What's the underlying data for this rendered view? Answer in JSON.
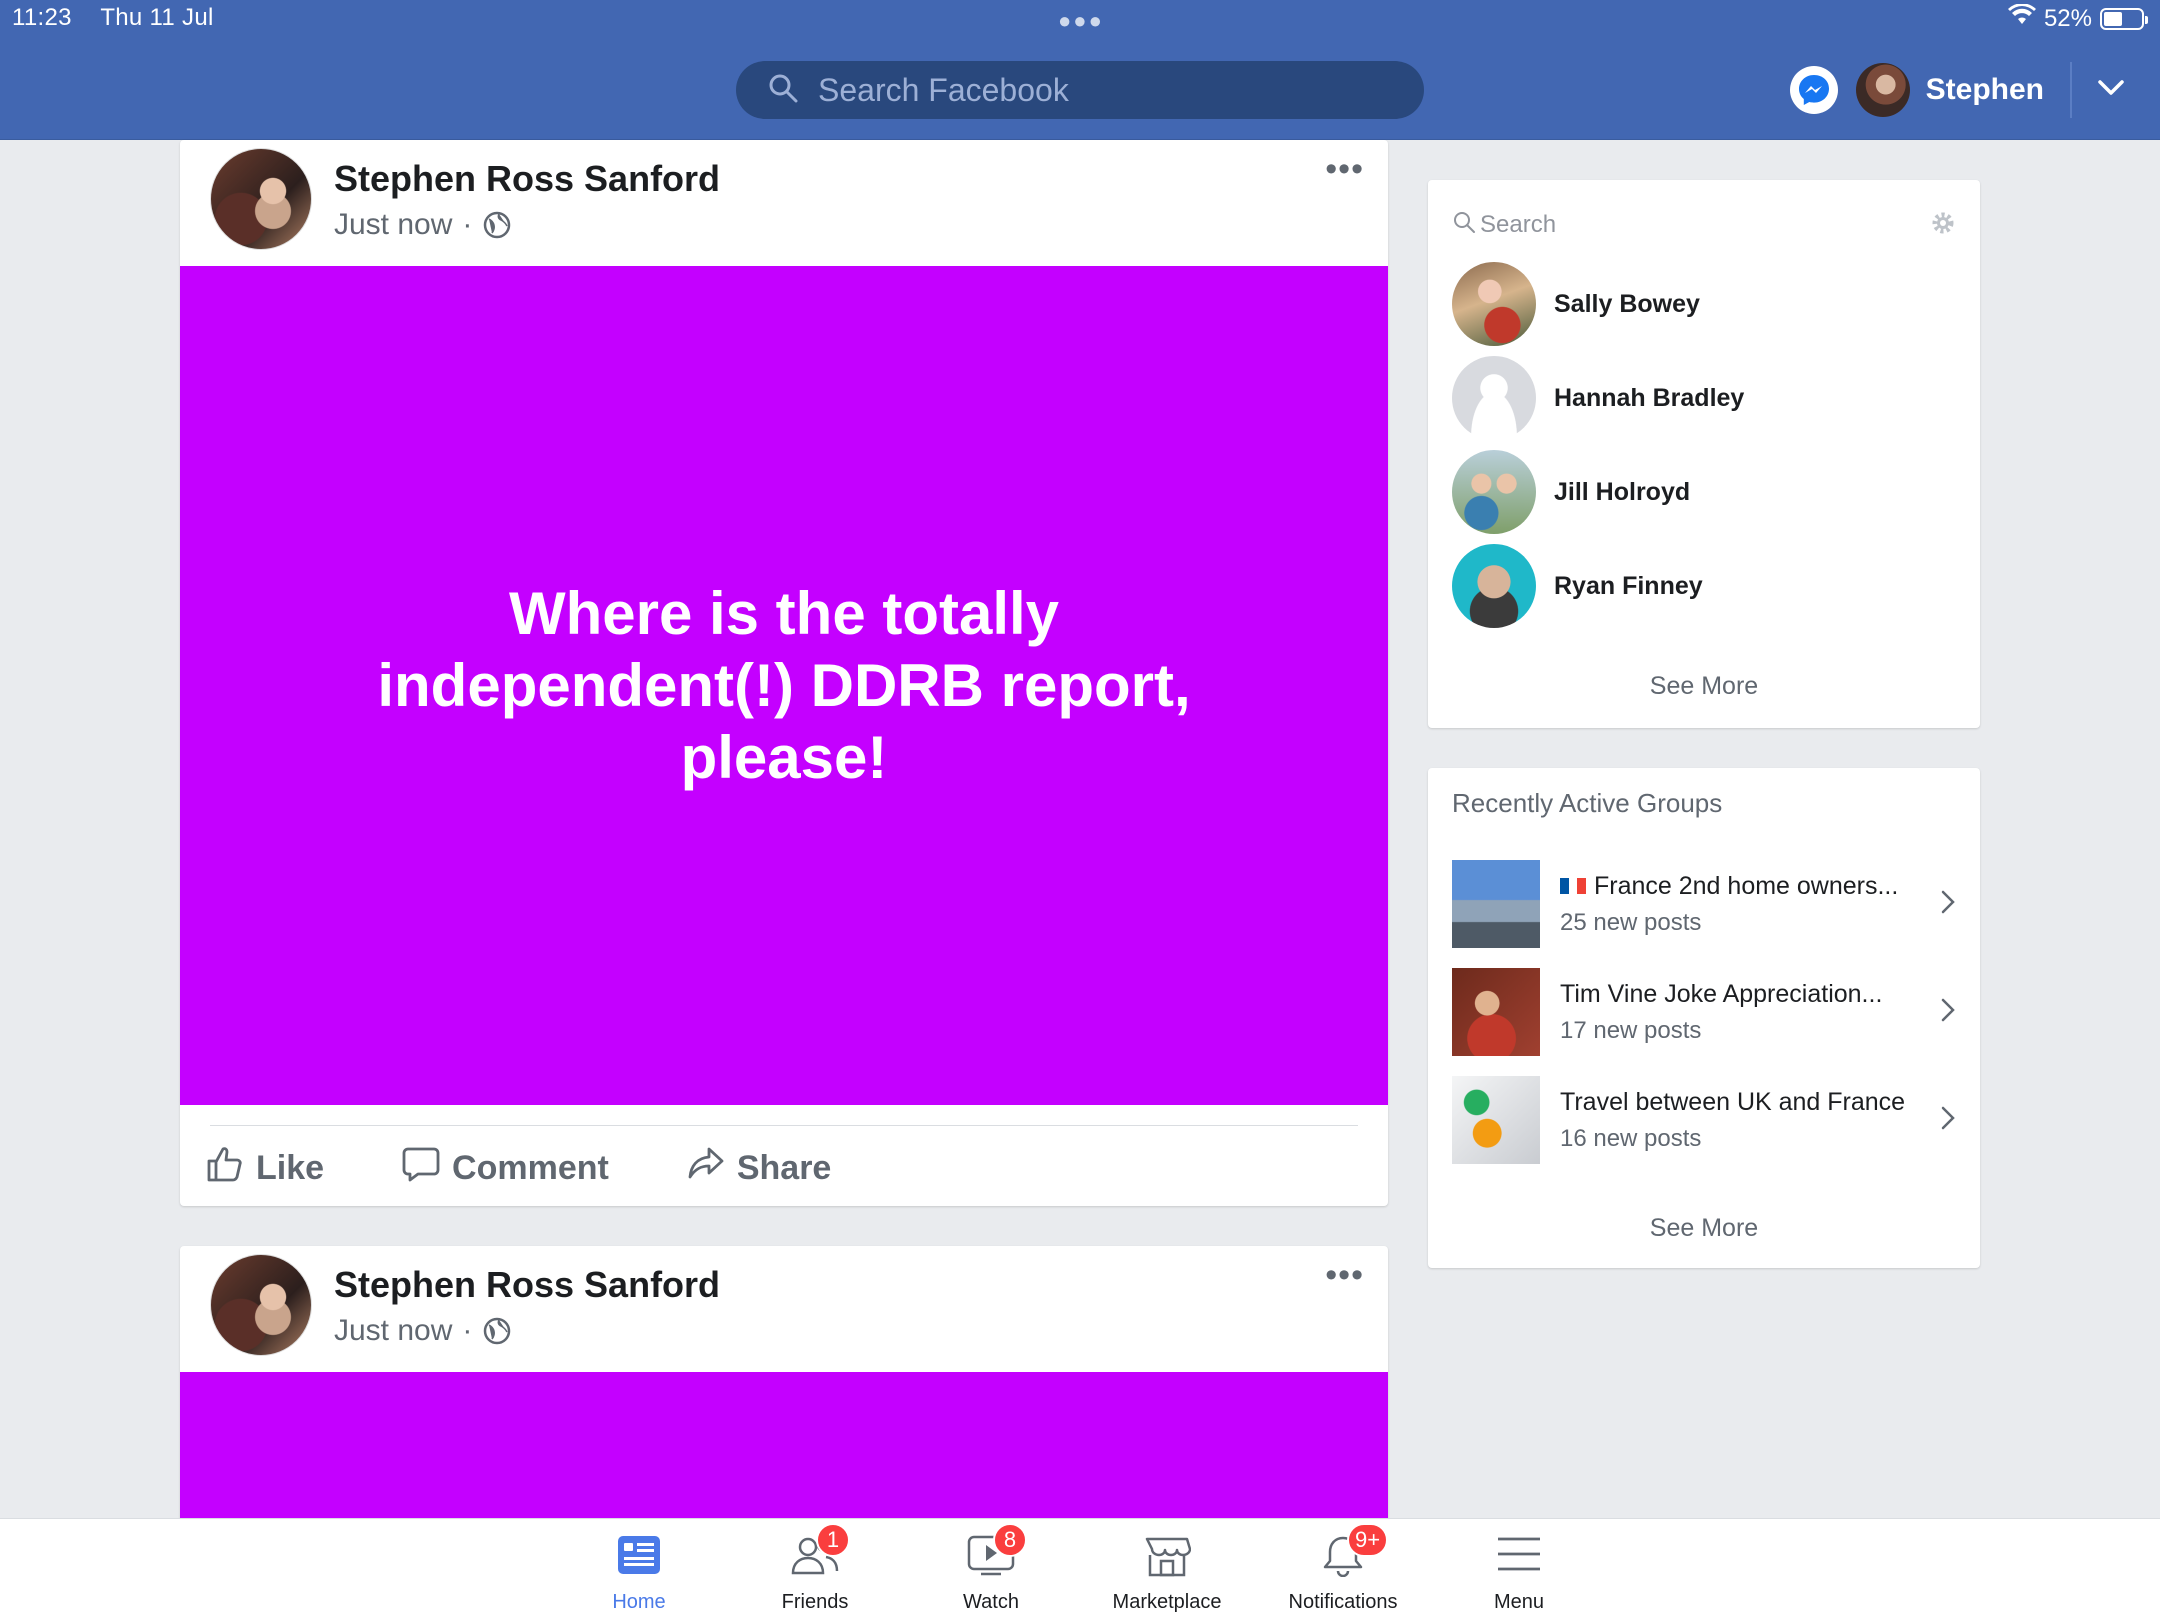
{
  "status_bar": {
    "time": "11:23",
    "date": "Thu 11 Jul",
    "battery": "52%"
  },
  "header": {
    "search_placeholder": "Search Facebook",
    "user_name": "Stephen"
  },
  "posts": [
    {
      "author": "Stephen Ross Sanford",
      "time": "Just now",
      "text": "Where is the totally independent(!) DDRB report, please!",
      "background": "#c400ff",
      "actions": {
        "like": "Like",
        "comment": "Comment",
        "share": "Share"
      }
    },
    {
      "author": "Stephen Ross Sanford",
      "time": "Just now",
      "background": "#c400ff"
    }
  ],
  "contacts": {
    "search_placeholder": "Search",
    "items": [
      {
        "name": "Sally Bowey"
      },
      {
        "name": "Hannah Bradley"
      },
      {
        "name": "Jill Holroyd"
      },
      {
        "name": "Ryan Finney"
      }
    ],
    "see_more": "See More"
  },
  "groups": {
    "title": "Recently Active Groups",
    "items": [
      {
        "name": "France 2nd home owners...",
        "sub": "25 new posts"
      },
      {
        "name": "Tim Vine Joke Appreciation...",
        "sub": "17 new posts"
      },
      {
        "name": "Travel between UK and France",
        "sub": "16 new posts"
      }
    ],
    "see_more": "See More"
  },
  "tabbar": {
    "tabs": [
      {
        "label": "Home",
        "badge": ""
      },
      {
        "label": "Friends",
        "badge": "1"
      },
      {
        "label": "Watch",
        "badge": "8"
      },
      {
        "label": "Marketplace",
        "badge": ""
      },
      {
        "label": "Notifications",
        "badge": "9+"
      },
      {
        "label": "Menu",
        "badge": ""
      }
    ],
    "active_color": "#4a7ae8"
  },
  "colors": {
    "brand": "#4267b2",
    "post_bg": "#c400ff",
    "badge": "#fa3e3e"
  }
}
